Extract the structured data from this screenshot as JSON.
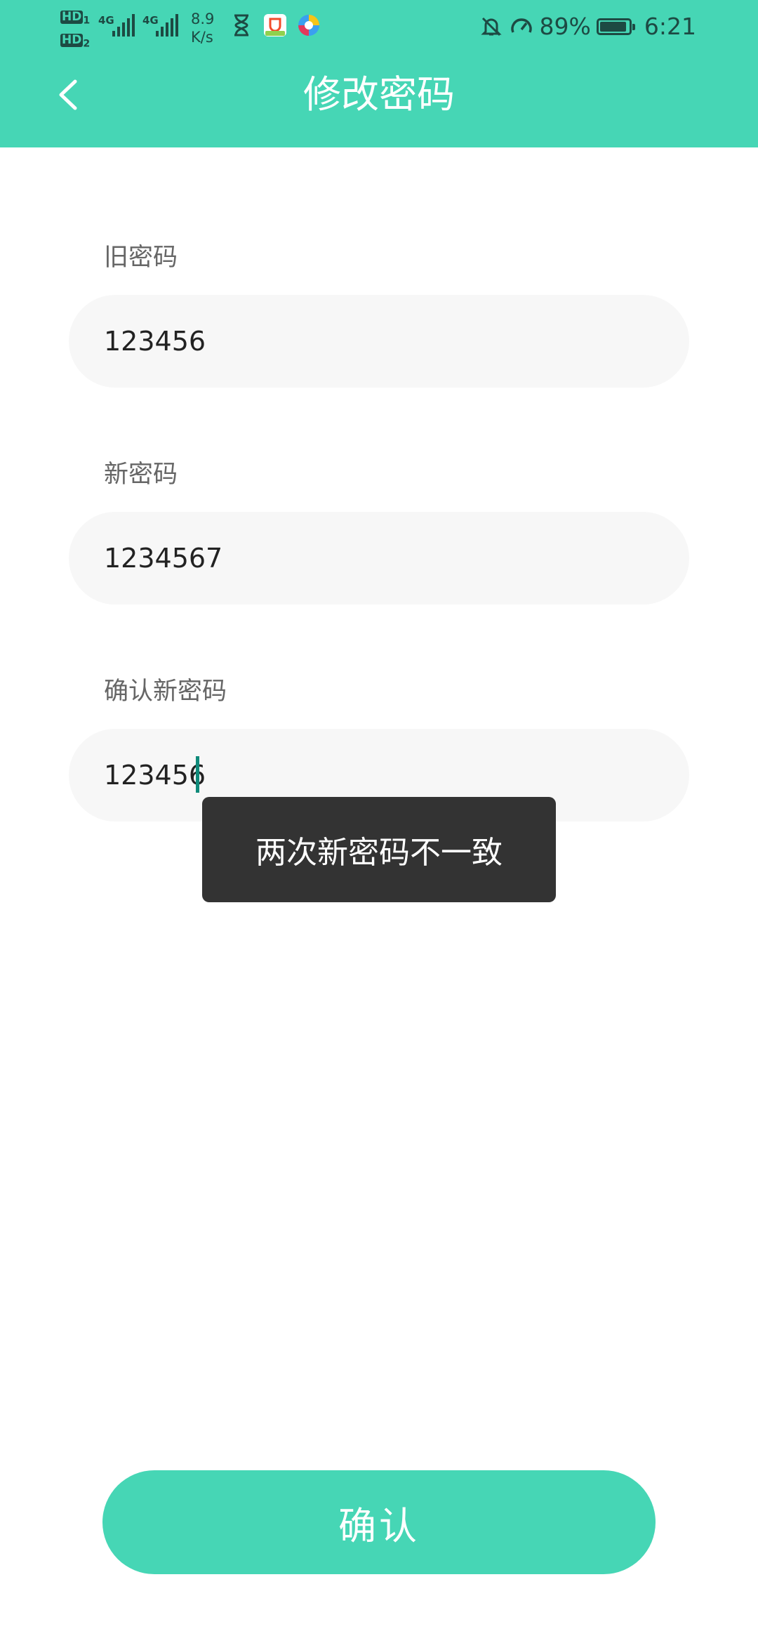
{
  "status_bar": {
    "hd_1": "HD",
    "hd_1_sub": "1",
    "hd_2": "HD",
    "hd_2_sub": "2",
    "network_1": "4G",
    "network_2": "4G",
    "speed_value": "8.9",
    "speed_unit": "K/s",
    "battery": "89%",
    "time": "6:21"
  },
  "header": {
    "title": "修改密码"
  },
  "form": {
    "old_password_label": "旧密码",
    "old_password_value": "123456",
    "new_password_label": "新密码",
    "new_password_value": "1234567",
    "confirm_password_label": "确认新密码",
    "confirm_password_value": "123456"
  },
  "toast": {
    "message": "两次新密码不一致"
  },
  "actions": {
    "confirm_label": "确认"
  },
  "colors": {
    "accent": "#46d6b5",
    "toast_bg": "#333333",
    "input_bg": "#f7f7f7"
  }
}
